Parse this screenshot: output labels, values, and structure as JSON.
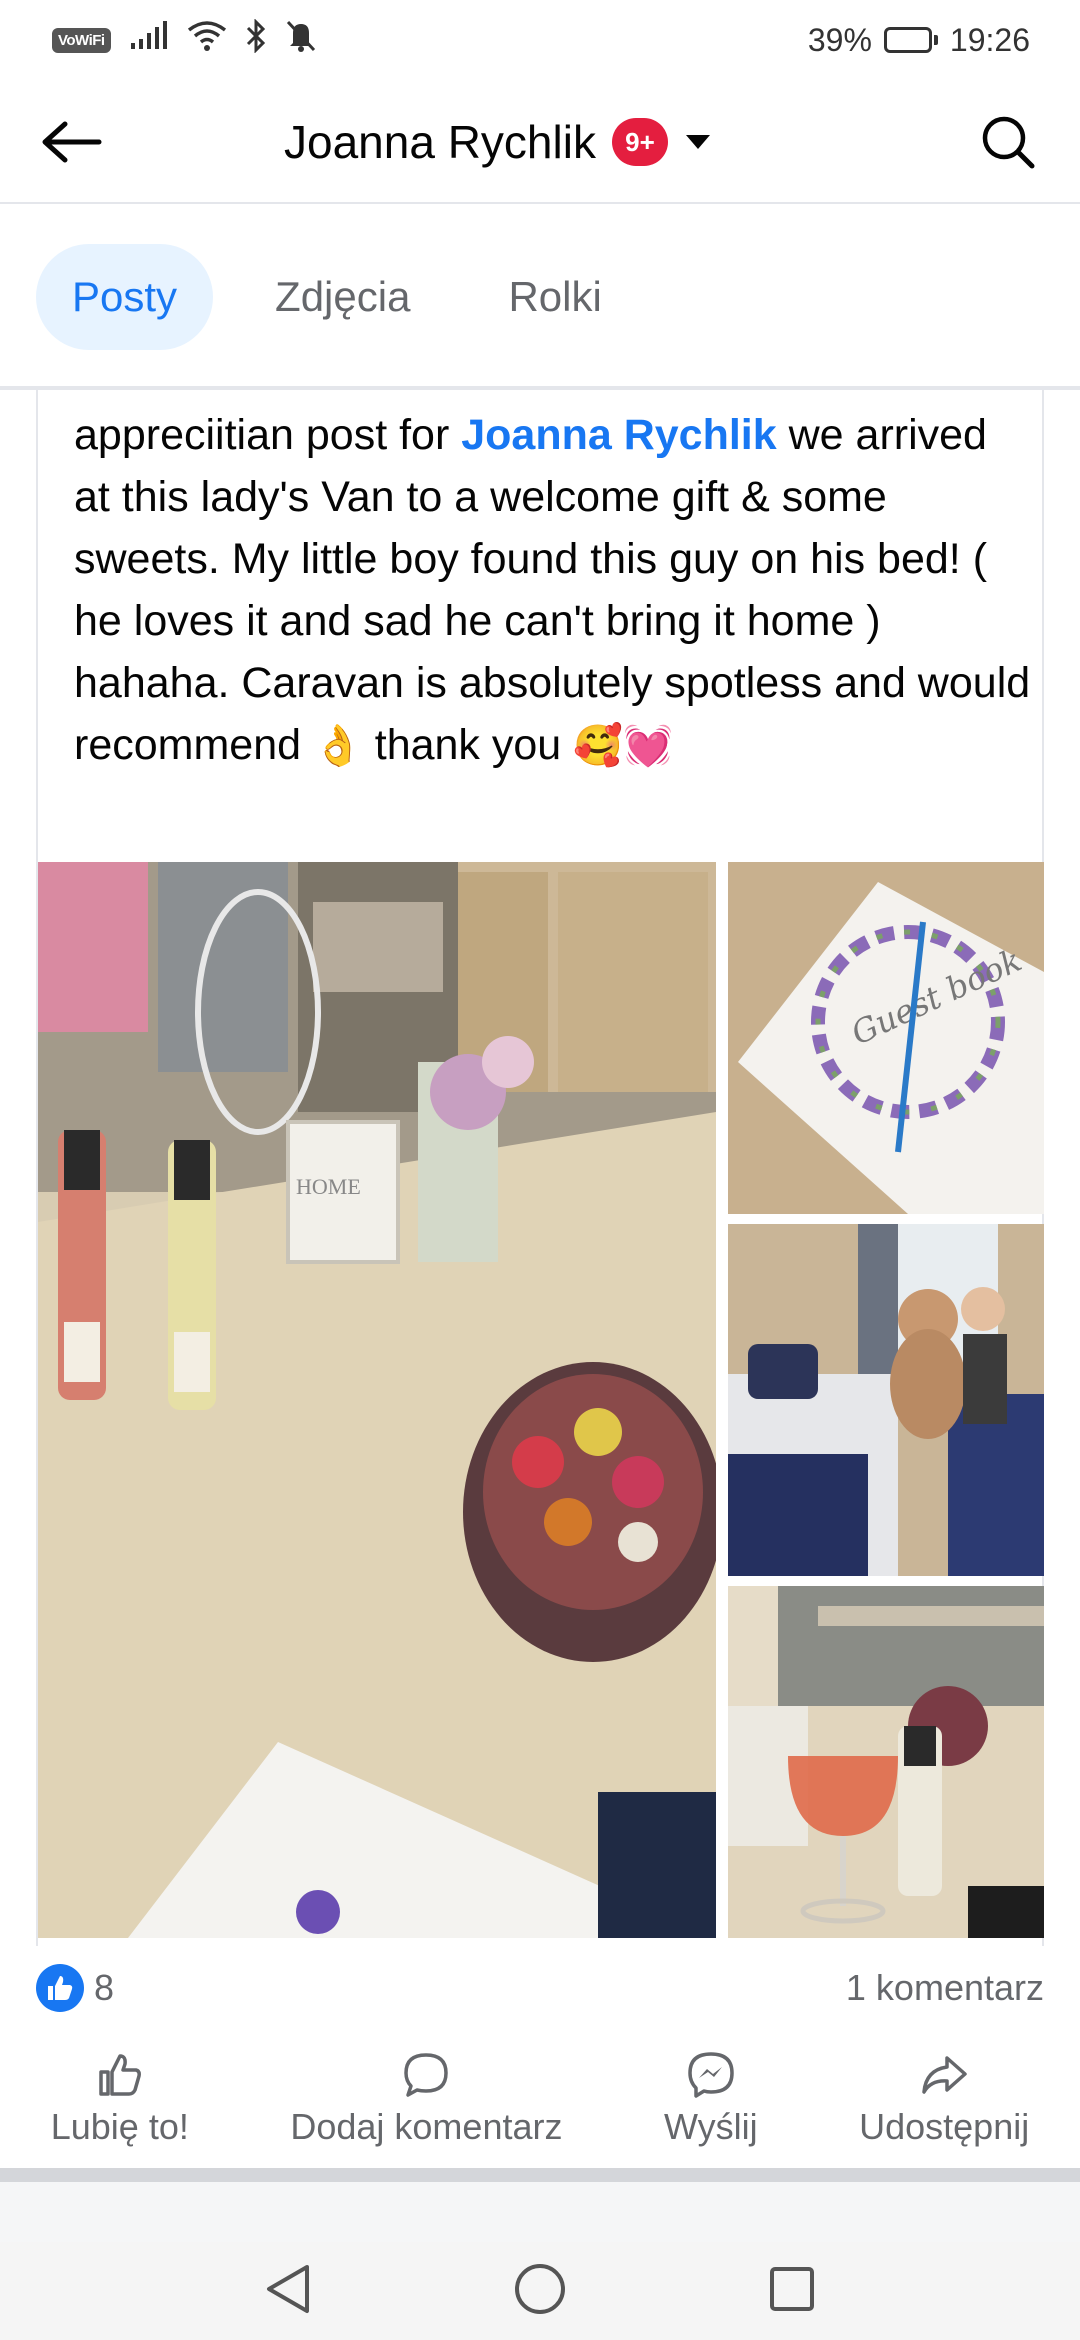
{
  "status_bar": {
    "vowifi": "VoWiFi",
    "battery": "39%",
    "time": "19:26"
  },
  "header": {
    "title": "Joanna Rychlik",
    "badge": "9+"
  },
  "tabs": [
    {
      "label": "Posty",
      "active": true
    },
    {
      "label": "Zdjęcia",
      "active": false
    },
    {
      "label": "Rolki",
      "active": false
    }
  ],
  "post": {
    "text_before": "appreciitian post for ",
    "mention": "Joanna Rychlik",
    "text_after": " we arrived at this lady's Van to a welcome gift & some sweets. My little boy found this guy on his bed! ( he loves it and sad he can't bring it home ) hahaha. Caravan is absolutely spotless and would recommend ",
    "emoji_ok": "👌",
    "thank_you": " thank you ",
    "emoji_hearts": "🥰💓",
    "images": [
      {
        "text": "HOME"
      },
      {
        "text": "Guest book"
      },
      {
        "text": ""
      },
      {
        "text": ""
      }
    ]
  },
  "reactions": {
    "likes": "8",
    "comments": "1 komentarz"
  },
  "actions": {
    "like": "Lubię to!",
    "comment": "Dodaj komentarz",
    "send": "Wyślij",
    "share": "Udostępnij"
  },
  "colors": {
    "accent": "#1877f2",
    "badge": "#e41e3f",
    "tab_active_bg": "#e7f3ff"
  }
}
